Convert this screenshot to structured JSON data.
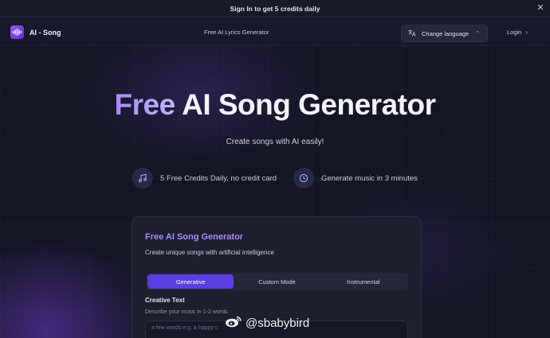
{
  "banner": {
    "text": "Sign In to get 5 credits daily",
    "close_icon": "close-icon"
  },
  "nav": {
    "brand": "AI - Song",
    "center_link": "Free AI Lyrics Generator",
    "language_button": "Change language",
    "login": "Login"
  },
  "hero": {
    "title_highlight": "Free",
    "title_rest": "AI Song Generator",
    "subtitle": "Create songs with AI easily!",
    "features": [
      {
        "icon": "music-note-icon",
        "text": "5 Free Credits Daily, no credit card"
      },
      {
        "icon": "clock-icon",
        "text": "Generate music in 3 minutes"
      }
    ]
  },
  "card": {
    "title": "Free AI Song Generator",
    "subtitle": "Create unique songs with artificial intelligence",
    "tabs": [
      {
        "label": "Generative",
        "active": true
      },
      {
        "label": "Custom Mode",
        "active": false
      },
      {
        "label": "Instrumental",
        "active": false
      }
    ],
    "field_label": "Creative Text",
    "field_help": "Describe your music in 1-2 words",
    "field_placeholder": "a few words e.g. a happy c"
  },
  "watermark": {
    "text": "@sbabybird",
    "icon": "weibo-icon"
  },
  "colors": {
    "accent": "#5b3ee0",
    "title_gradient_start": "#a78bfa",
    "background": "#141626"
  }
}
